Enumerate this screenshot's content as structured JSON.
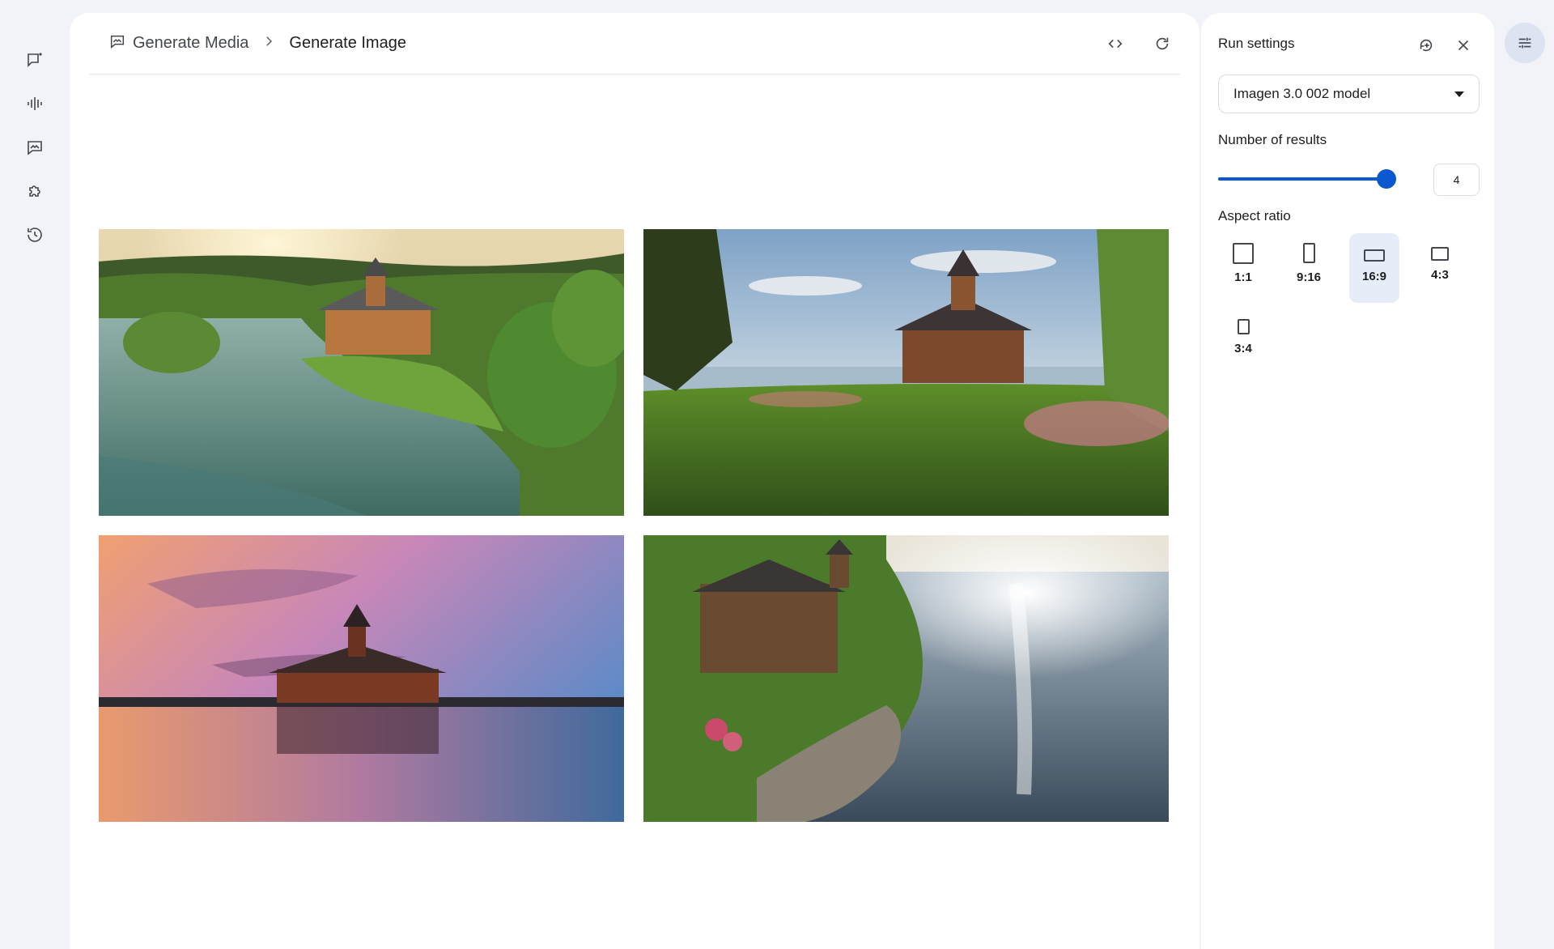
{
  "rail": {
    "items": [
      {
        "icon": "chat-icon"
      },
      {
        "icon": "audio-icon"
      },
      {
        "icon": "image-icon"
      },
      {
        "icon": "extensions-icon"
      },
      {
        "icon": "history-icon"
      }
    ]
  },
  "header": {
    "breadcrumb_root": "Generate Media",
    "breadcrumb_current": "Generate Image",
    "actions": [
      "code-icon",
      "refresh-icon"
    ]
  },
  "images": [
    {
      "name": "lakeside-lodge-aerial-sunset"
    },
    {
      "name": "lodge-on-lawn-by-lake"
    },
    {
      "name": "lodge-island-pink-sunset"
    },
    {
      "name": "lodge-rocky-shore-sun-glare"
    }
  ],
  "settings": {
    "title": "Run settings",
    "model": "Imagen 3.0 002 model",
    "results_label": "Number of results",
    "results_value": "4",
    "results_level": 1.0,
    "aspect_label": "Aspect ratio",
    "aspect_options": [
      {
        "label": "1:1",
        "selected": false
      },
      {
        "label": "9:16",
        "selected": false
      },
      {
        "label": "16:9",
        "selected": true
      },
      {
        "label": "4:3",
        "selected": false
      },
      {
        "label": "3:4",
        "selected": false
      }
    ]
  },
  "colors": {
    "accent": "#0b57d0",
    "selected_bg": "#e6ecf8",
    "page_bg": "#f1f3f8"
  }
}
